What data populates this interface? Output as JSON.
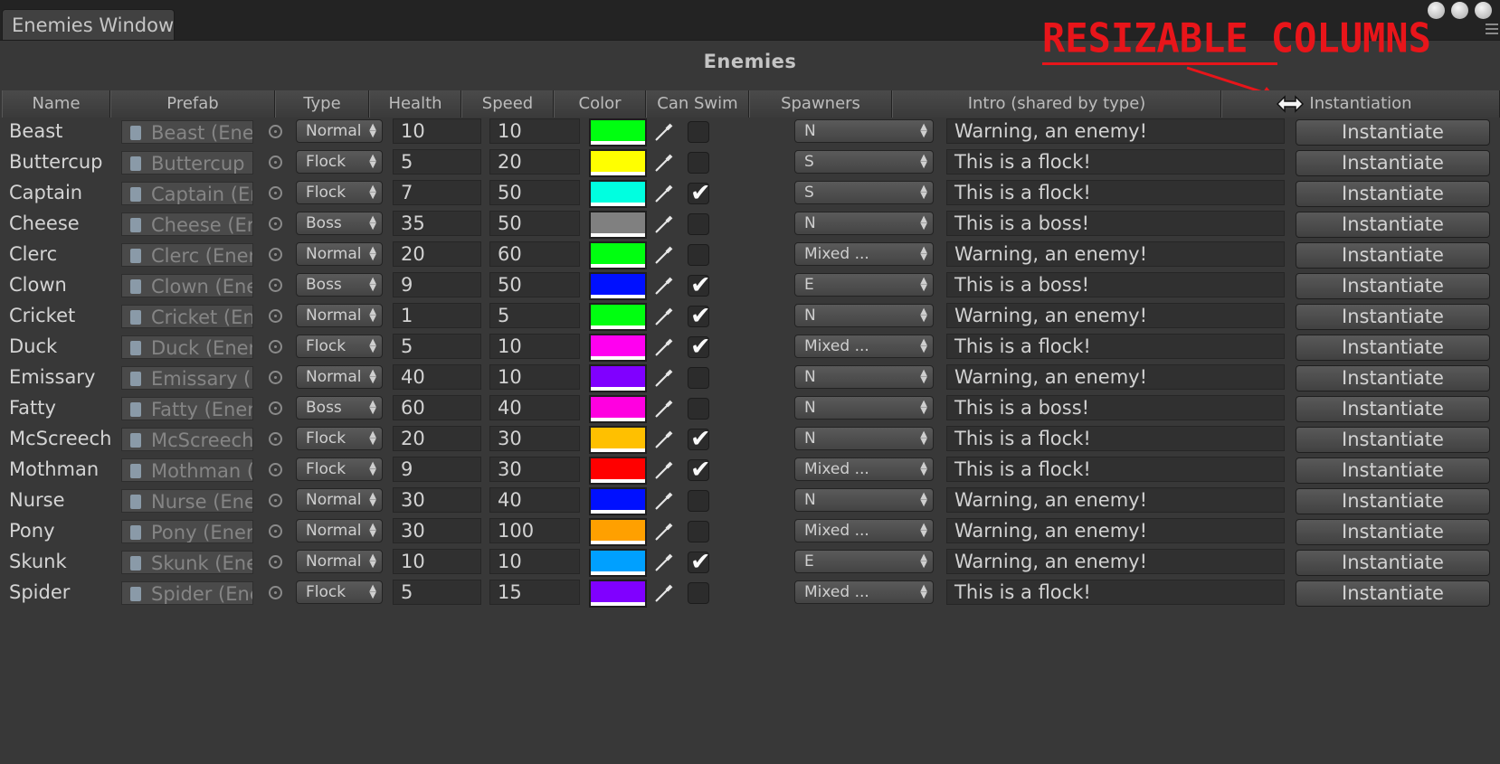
{
  "window": {
    "tab_label": "Enemies Window",
    "title": "Enemies"
  },
  "annotation": {
    "text": "RESIZABLE COLUMNS",
    "color": "#e8151a"
  },
  "columns": [
    "Name",
    "Prefab",
    "Type",
    "Health",
    "Speed",
    "Color",
    "Can Swim",
    "Spawners",
    "Intro (shared by type)",
    "Instantiation"
  ],
  "rows": [
    {
      "name": "Beast",
      "prefab": "Beast (Ener",
      "type": "Normal",
      "health": "10",
      "speed": "10",
      "color": "#00ff10",
      "can_swim": false,
      "spawners": "N",
      "intro": "Warning, an enemy!",
      "button": "Instantiate"
    },
    {
      "name": "Buttercup",
      "prefab": "Buttercup (",
      "type": "Flock",
      "health": "5",
      "speed": "20",
      "color": "#ffff00",
      "can_swim": false,
      "spawners": "S",
      "intro": "This is a flock!",
      "button": "Instantiate"
    },
    {
      "name": "Captain",
      "prefab": "Captain (Er",
      "type": "Flock",
      "health": "7",
      "speed": "50",
      "color": "#00ffe0",
      "can_swim": true,
      "spawners": "S",
      "intro": "This is a flock!",
      "button": "Instantiate"
    },
    {
      "name": "Cheese",
      "prefab": "Cheese (Er",
      "type": "Boss",
      "health": "35",
      "speed": "50",
      "color": "#808080",
      "can_swim": false,
      "spawners": "N",
      "intro": "This is a boss!",
      "button": "Instantiate"
    },
    {
      "name": "Clerc",
      "prefab": "Clerc (Ener",
      "type": "Normal",
      "health": "20",
      "speed": "60",
      "color": "#00ff10",
      "can_swim": false,
      "spawners": "Mixed ...",
      "intro": "Warning, an enemy!",
      "button": "Instantiate"
    },
    {
      "name": "Clown",
      "prefab": "Clown (Ene",
      "type": "Boss",
      "health": "9",
      "speed": "50",
      "color": "#0010ff",
      "can_swim": true,
      "spawners": "E",
      "intro": "This is a boss!",
      "button": "Instantiate"
    },
    {
      "name": "Cricket",
      "prefab": "Cricket (En",
      "type": "Normal",
      "health": "1",
      "speed": "5",
      "color": "#00ff10",
      "can_swim": true,
      "spawners": "N",
      "intro": "Warning, an enemy!",
      "button": "Instantiate"
    },
    {
      "name": "Duck",
      "prefab": "Duck (Ener",
      "type": "Flock",
      "health": "5",
      "speed": "10",
      "color": "#ff00f0",
      "can_swim": true,
      "spawners": "Mixed ...",
      "intro": "This is a flock!",
      "button": "Instantiate"
    },
    {
      "name": "Emissary",
      "prefab": "Emissary (",
      "type": "Normal",
      "health": "40",
      "speed": "10",
      "color": "#8000ff",
      "can_swim": false,
      "spawners": "N",
      "intro": "Warning, an enemy!",
      "button": "Instantiate"
    },
    {
      "name": "Fatty",
      "prefab": "Fatty (Ener",
      "type": "Boss",
      "health": "60",
      "speed": "40",
      "color": "#ff00e0",
      "can_swim": false,
      "spawners": "N",
      "intro": "This is a boss!",
      "button": "Instantiate"
    },
    {
      "name": "McScreech",
      "prefab": "McScreech",
      "type": "Flock",
      "health": "20",
      "speed": "30",
      "color": "#ffc000",
      "can_swim": true,
      "spawners": "N",
      "intro": "This is a flock!",
      "button": "Instantiate"
    },
    {
      "name": "Mothman",
      "prefab": "Mothman (",
      "type": "Flock",
      "health": "9",
      "speed": "30",
      "color": "#ff0000",
      "can_swim": true,
      "spawners": "Mixed ...",
      "intro": "This is a flock!",
      "button": "Instantiate"
    },
    {
      "name": "Nurse",
      "prefab": "Nurse (Ene",
      "type": "Normal",
      "health": "30",
      "speed": "40",
      "color": "#0010ff",
      "can_swim": false,
      "spawners": "N",
      "intro": "Warning, an enemy!",
      "button": "Instantiate"
    },
    {
      "name": "Pony",
      "prefab": "Pony (Ener",
      "type": "Normal",
      "health": "30",
      "speed": "100",
      "color": "#ffa000",
      "can_swim": false,
      "spawners": "Mixed ...",
      "intro": "Warning, an enemy!",
      "button": "Instantiate"
    },
    {
      "name": "Skunk",
      "prefab": "Skunk (Ene",
      "type": "Normal",
      "health": "10",
      "speed": "10",
      "color": "#00a0ff",
      "can_swim": true,
      "spawners": "E",
      "intro": "Warning, an enemy!",
      "button": "Instantiate"
    },
    {
      "name": "Spider",
      "prefab": "Spider (Ene",
      "type": "Flock",
      "health": "5",
      "speed": "15",
      "color": "#8000ff",
      "can_swim": false,
      "spawners": "Mixed ...",
      "intro": "This is a flock!",
      "button": "Instantiate"
    }
  ]
}
